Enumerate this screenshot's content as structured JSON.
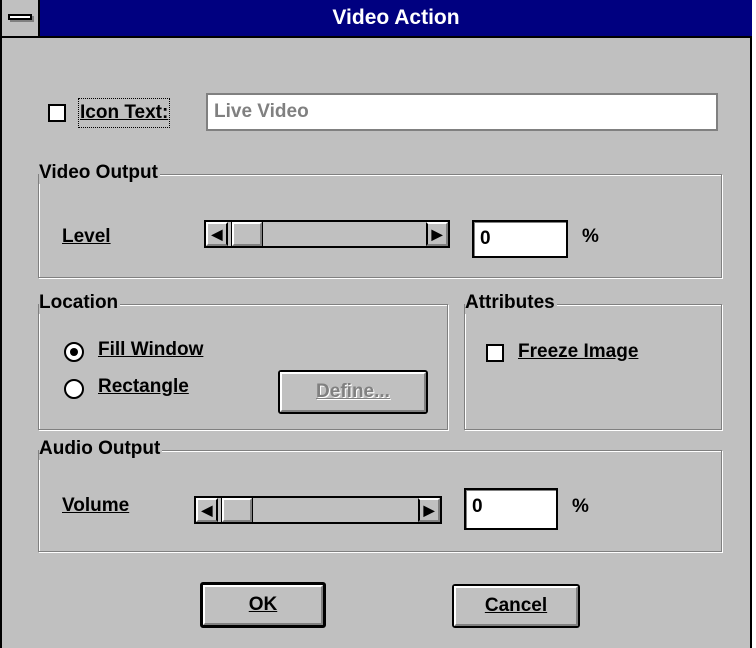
{
  "window": {
    "title": "Video Action"
  },
  "icon_text": {
    "label": "Icon Text:",
    "value": "Live Video",
    "checked": false
  },
  "video_output": {
    "group_label": "Video Output",
    "level_label": "Level",
    "level_value": "0",
    "unit": "%",
    "slider_fraction": 0
  },
  "location": {
    "group_label": "Location",
    "fill_window_label": "Fill Window",
    "rectangle_label": "Rectangle",
    "selected": "Fill Window",
    "define_label": "Define..."
  },
  "attributes": {
    "group_label": "Attributes",
    "freeze_label": "Freeze Image",
    "freeze_checked": false
  },
  "audio_output": {
    "group_label": "Audio Output",
    "volume_label": "Volume",
    "volume_value": "0",
    "unit": "%",
    "slider_fraction": 0
  },
  "buttons": {
    "ok_label": "OK",
    "cancel_label": "Cancel"
  },
  "colors": {
    "titlebar": "#000080",
    "face": "#c0c0c0",
    "disabled_text": "#808080"
  },
  "icons": {
    "system_menu": "system-menu-icon",
    "scroll_left": "arrow-left-icon",
    "scroll_right": "arrow-right-icon"
  }
}
